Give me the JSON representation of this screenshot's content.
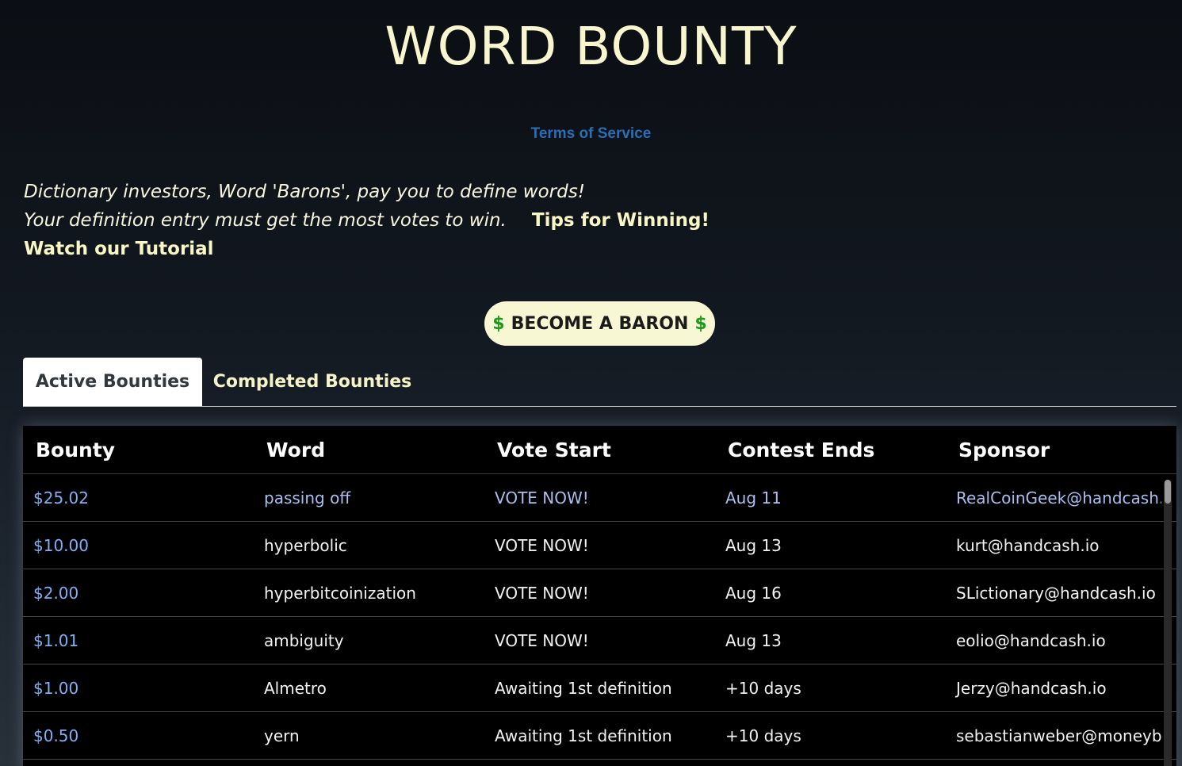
{
  "header": {
    "title": "WORD BOUNTY",
    "terms_link": "Terms of Service"
  },
  "intro": {
    "line1": "Dictionary investors, Word 'Barons', pay you to define words!",
    "line2": "Your definition entry must get the most votes to win.",
    "tips_link": "Tips for Winning!",
    "tutorial_link": "Watch our Tutorial"
  },
  "cta": {
    "dollar_left": "$",
    "label": "BECOME A BARON",
    "dollar_right": "$"
  },
  "tabs": [
    {
      "label": "Active Bounties",
      "active": true
    },
    {
      "label": "Completed Bounties",
      "active": false
    }
  ],
  "table": {
    "columns": [
      "Bounty",
      "Word",
      "Vote Start",
      "Contest Ends",
      "Sponsor"
    ],
    "rows": [
      {
        "bounty": "$25.02",
        "word": "passing off",
        "vote": "VOTE NOW!",
        "ends": "Aug 11",
        "sponsor": "RealCoinGeek@handcash.io"
      },
      {
        "bounty": "$10.00",
        "word": "hyperbolic",
        "vote": "VOTE NOW!",
        "ends": "Aug 13",
        "sponsor": "kurt@handcash.io"
      },
      {
        "bounty": "$2.00",
        "word": "hyperbitcoinization",
        "vote": "VOTE NOW!",
        "ends": "Aug 16",
        "sponsor": "SLictionary@handcash.io"
      },
      {
        "bounty": "$1.01",
        "word": "ambiguity",
        "vote": "VOTE NOW!",
        "ends": "Aug 13",
        "sponsor": "eolio@handcash.io"
      },
      {
        "bounty": "$1.00",
        "word": "Almetro",
        "vote": "Awaiting 1st definition",
        "ends": "+10 days",
        "sponsor": "Jerzy@handcash.io"
      },
      {
        "bounty": "$0.50",
        "word": "yern",
        "vote": "Awaiting 1st definition",
        "ends": "+10 days",
        "sponsor": "sebastianweber@moneyb..."
      }
    ]
  },
  "colors": {
    "accent": "#f8f7d4",
    "link_blue": "#2a6eb4",
    "bounty_blue": "#7fb0f5",
    "dollar_green": "#1c9a1c"
  }
}
